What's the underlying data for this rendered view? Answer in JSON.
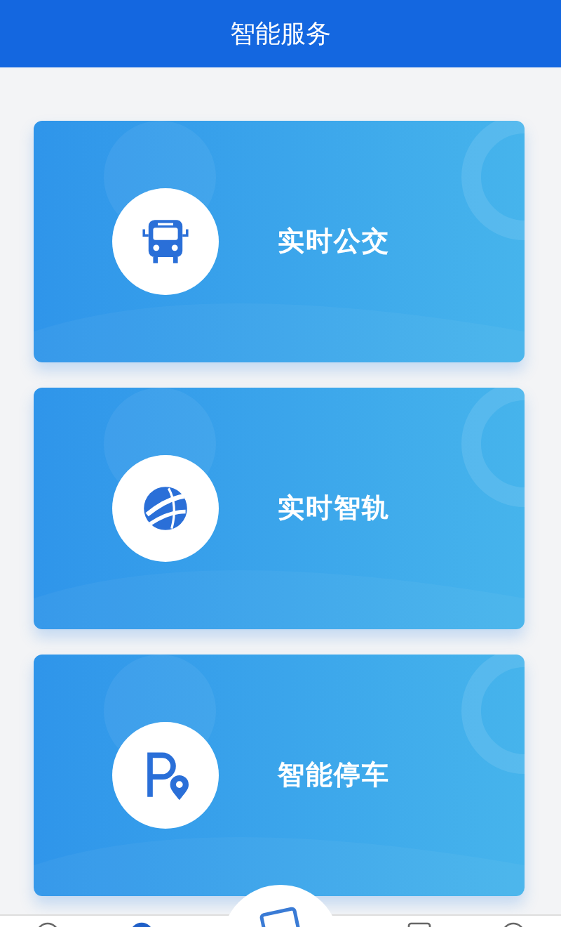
{
  "header": {
    "title": "智能服务"
  },
  "services": [
    {
      "label": "实时公交",
      "kind": "bus"
    },
    {
      "label": "实时智轨",
      "kind": "rail"
    },
    {
      "label": "智能停车",
      "kind": "parking"
    }
  ],
  "tab_bar": [
    {
      "kind": "circle",
      "selected": false
    },
    {
      "kind": "circle",
      "selected": true
    },
    {
      "kind": "center",
      "selected": false
    },
    {
      "kind": "square",
      "selected": false
    },
    {
      "kind": "circle",
      "selected": false
    }
  ]
}
